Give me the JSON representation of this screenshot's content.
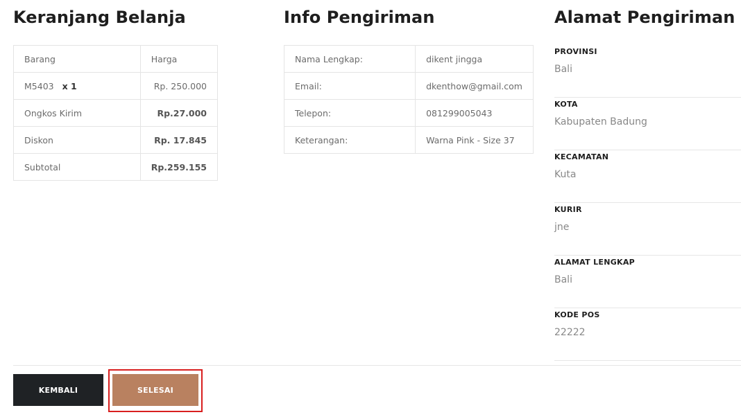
{
  "cart": {
    "title": "Keranjang Belanja",
    "header": {
      "item": "Barang",
      "price": "Harga"
    },
    "item": {
      "code": "M5403",
      "qty": "x 1",
      "price": "Rp. 250.000"
    },
    "shipping": {
      "label": "Ongkos Kirim",
      "value": "Rp.27.000"
    },
    "discount": {
      "label": "Diskon",
      "value": "Rp. 17.845"
    },
    "subtotal": {
      "label": "Subtotal",
      "value": "Rp.259.155"
    }
  },
  "shipping_info": {
    "title": "Info Pengiriman",
    "rows": [
      {
        "label": "Nama Lengkap:",
        "value": "dikent jingga"
      },
      {
        "label": "Email:",
        "value": "dkenthow@gmail.com"
      },
      {
        "label": "Telepon:",
        "value": "081299005043"
      },
      {
        "label": "Keterangan:",
        "value": "Warna Pink - Size 37"
      }
    ]
  },
  "address": {
    "title": "Alamat Pengiriman",
    "fields": [
      {
        "label": "PROVINSI",
        "value": "Bali"
      },
      {
        "label": "KOTA",
        "value": "Kabupaten Badung"
      },
      {
        "label": "KECAMATAN",
        "value": "Kuta"
      },
      {
        "label": "KURIR",
        "value": "jne"
      },
      {
        "label": "ALAMAT LENGKAP",
        "value": "Bali"
      },
      {
        "label": "KODE POS",
        "value": "22222"
      }
    ]
  },
  "actions": {
    "back_label": "KEMBALI",
    "finish_label": "SELESAI"
  },
  "colors": {
    "back_button": "#1f2225",
    "finish_button": "#b98160",
    "highlight_border": "#d81e1e"
  }
}
